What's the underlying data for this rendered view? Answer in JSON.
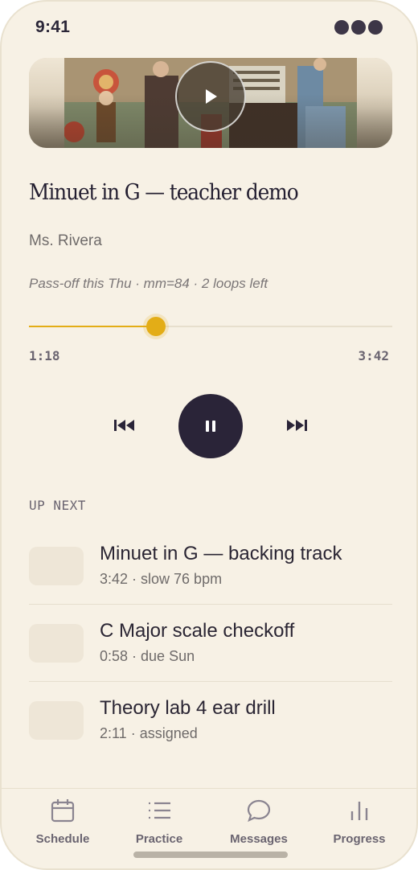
{
  "status_bar": {
    "time": "9:41"
  },
  "now_playing": {
    "title": "Minuet in G — teacher demo",
    "artist": "Ms. Rivera",
    "note": "Pass-off this Thu · mm=84 · 2 loops left",
    "progress": 0.35,
    "elapsed": "1:18",
    "duration": "3:42"
  },
  "queue": {
    "heading": "UP NEXT",
    "items": [
      {
        "title": "Minuet in G — backing track",
        "meta": "3:42 · slow 76 bpm"
      },
      {
        "title": "C Major scale checkoff",
        "meta": "0:58 · due Sun"
      },
      {
        "title": "Theory lab 4 ear drill",
        "meta": "2:11 · assigned"
      }
    ]
  },
  "tabs": [
    {
      "label": "Schedule",
      "icon": "calendar-icon"
    },
    {
      "label": "Practice",
      "icon": "list-icon"
    },
    {
      "label": "Messages",
      "icon": "chat-bubble-icon"
    },
    {
      "label": "Progress",
      "icon": "bar-chart-icon"
    }
  ],
  "colors": {
    "accent": "#e3ad17",
    "dark": "#2a2438",
    "background": "#f7f1e5"
  }
}
